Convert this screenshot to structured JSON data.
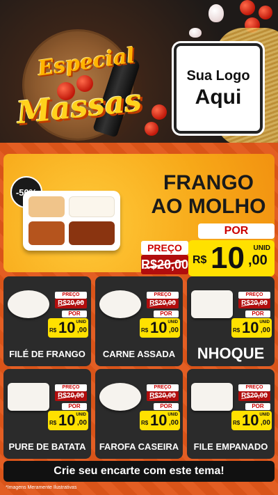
{
  "header": {
    "title_line1": "Especial",
    "title_line2": "Massas",
    "logo_line1": "Sua Logo",
    "logo_line2": "Aqui"
  },
  "feature": {
    "discount": "-50%",
    "name_line1": "FRANGO",
    "name_line2": "AO MOLHO",
    "price_label": "PREÇO",
    "old_price": "R$20,00",
    "por_label": "POR",
    "currency": "R$",
    "price_int": "10",
    "price_dec": ",00",
    "unit": "UNID"
  },
  "cards": [
    {
      "name": "FILÉ DE FRANGO",
      "price_label": "PREÇO",
      "old_price": "R$20,00",
      "por_label": "POR",
      "currency": "R$",
      "price_int": "10",
      "price_dec": ",00",
      "unit": "UNID"
    },
    {
      "name": "CARNE ASSADA",
      "price_label": "PREÇO",
      "old_price": "R$20,00",
      "por_label": "POR",
      "currency": "R$",
      "price_int": "10",
      "price_dec": ",00",
      "unit": "UNID"
    },
    {
      "name": "NHOQUE",
      "price_label": "PREÇO",
      "old_price": "R$20,00",
      "por_label": "POR",
      "currency": "R$",
      "price_int": "10",
      "price_dec": ",00",
      "unit": "UNID"
    },
    {
      "name": "PURE DE BATATA",
      "price_label": "PREÇO",
      "old_price": "R$20,00",
      "por_label": "POR",
      "currency": "R$",
      "price_int": "10",
      "price_dec": ",00",
      "unit": "UNID"
    },
    {
      "name": "FAROFA CASEIRA",
      "price_label": "PREÇO",
      "old_price": "R$20,00",
      "por_label": "POR",
      "currency": "R$",
      "price_int": "10",
      "price_dec": ",00",
      "unit": "UNID"
    },
    {
      "name": "FILE EMPANADO",
      "price_label": "PREÇO",
      "old_price": "R$20,00",
      "por_label": "POR",
      "currency": "R$",
      "price_int": "10",
      "price_dec": ",00",
      "unit": "UNID"
    }
  ],
  "cta": {
    "label": "Crie seu encarte com este tema!"
  },
  "footer": {
    "note": "*Imagens Meramente Ilustrativas"
  },
  "colors": {
    "band": "#e2571a",
    "price_yellow": "#ffe100",
    "old_red": "#b10d0d",
    "card_bg": "#2b2b2b"
  }
}
